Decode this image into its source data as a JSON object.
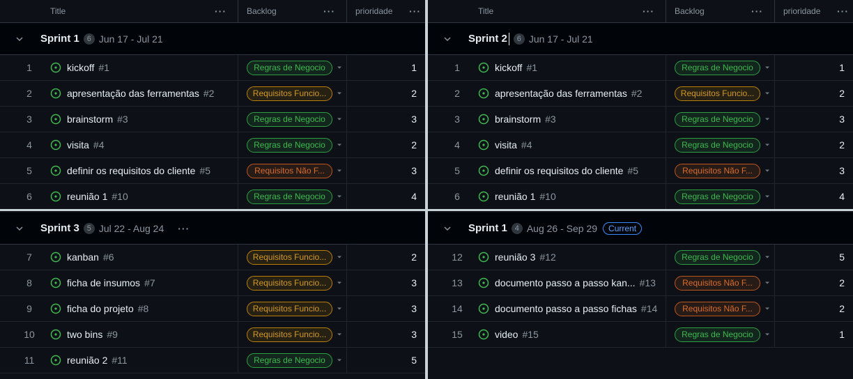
{
  "columns": {
    "title": "Title",
    "backlog": "Backlog",
    "priority": "prioridade"
  },
  "quadrants": {
    "tl": {
      "group": {
        "name": "Sprint 1",
        "count": "6",
        "dates": "Jun 17 - Jul 21"
      },
      "rows": [
        {
          "num": "1",
          "title": "kickoff",
          "ref": "#1",
          "backlog": "Regras de Negocio",
          "color": "green",
          "prio": "1"
        },
        {
          "num": "2",
          "title": "apresentação das ferramentas",
          "ref": "#2",
          "backlog": "Requisitos Funcio...",
          "color": "yellow",
          "prio": "2"
        },
        {
          "num": "3",
          "title": "brainstorm",
          "ref": "#3",
          "backlog": "Regras de Negocio",
          "color": "green",
          "prio": "3"
        },
        {
          "num": "4",
          "title": "visita",
          "ref": "#4",
          "backlog": "Regras de Negocio",
          "color": "green",
          "prio": "2"
        },
        {
          "num": "5",
          "title": "definir os requisitos do cliente",
          "ref": "#5",
          "backlog": "Requisitos Não F...",
          "color": "orange",
          "prio": "3"
        },
        {
          "num": "6",
          "title": "reunião 1",
          "ref": "#10",
          "backlog": "Regras de Negocio",
          "color": "green",
          "prio": "4"
        }
      ]
    },
    "tr": {
      "group": {
        "name": "Sprint 2",
        "count": "6",
        "dates": "Jun 17 - Jul 21"
      },
      "rows": [
        {
          "num": "1",
          "title": "kickoff",
          "ref": "#1",
          "backlog": "Regras de Negocio",
          "color": "green",
          "prio": "1"
        },
        {
          "num": "2",
          "title": "apresentação das ferramentas",
          "ref": "#2",
          "backlog": "Requisitos Funcio...",
          "color": "yellow",
          "prio": "2"
        },
        {
          "num": "3",
          "title": "brainstorm",
          "ref": "#3",
          "backlog": "Regras de Negocio",
          "color": "green",
          "prio": "3"
        },
        {
          "num": "4",
          "title": "visita",
          "ref": "#4",
          "backlog": "Regras de Negocio",
          "color": "green",
          "prio": "2"
        },
        {
          "num": "5",
          "title": "definir os requisitos do cliente",
          "ref": "#5",
          "backlog": "Requisitos Não F...",
          "color": "orange",
          "prio": "3"
        },
        {
          "num": "6",
          "title": "reunião 1",
          "ref": "#10",
          "backlog": "Regras de Negocio",
          "color": "green",
          "prio": "4"
        }
      ]
    },
    "bl": {
      "group": {
        "name": "Sprint 3",
        "count": "5",
        "dates": "Jul 22 - Aug 24"
      },
      "rows": [
        {
          "num": "7",
          "title": "kanban",
          "ref": "#6",
          "backlog": "Requisitos Funcio...",
          "color": "yellow",
          "prio": "2"
        },
        {
          "num": "8",
          "title": "ficha de insumos",
          "ref": "#7",
          "backlog": "Requisitos Funcio...",
          "color": "yellow",
          "prio": "3"
        },
        {
          "num": "9",
          "title": "ficha do projeto",
          "ref": "#8",
          "backlog": "Requisitos Funcio...",
          "color": "yellow",
          "prio": "3"
        },
        {
          "num": "10",
          "title": "two bins",
          "ref": "#9",
          "backlog": "Requisitos Funcio...",
          "color": "yellow",
          "prio": "3"
        },
        {
          "num": "11",
          "title": "reunião 2",
          "ref": "#11",
          "backlog": "Regras de Negocio",
          "color": "green",
          "prio": "5"
        }
      ]
    },
    "br": {
      "group": {
        "name": "Sprint 1",
        "count": "4",
        "dates": "Aug 26 - Sep 29",
        "badge": "Current"
      },
      "rows": [
        {
          "num": "12",
          "title": "reunião 3",
          "ref": "#12",
          "backlog": "Regras de Negocio",
          "color": "green",
          "prio": "5"
        },
        {
          "num": "13",
          "title": "documento passo a passo kan...",
          "ref": "#13",
          "backlog": "Requisitos Não F...",
          "color": "orange",
          "prio": "2"
        },
        {
          "num": "14",
          "title": "documento passo a passo fichas",
          "ref": "#14",
          "backlog": "Requisitos Não F...",
          "color": "orange",
          "prio": "2"
        },
        {
          "num": "15",
          "title": "video",
          "ref": "#15",
          "backlog": "Regras de Negocio",
          "color": "green",
          "prio": "1"
        }
      ]
    }
  }
}
